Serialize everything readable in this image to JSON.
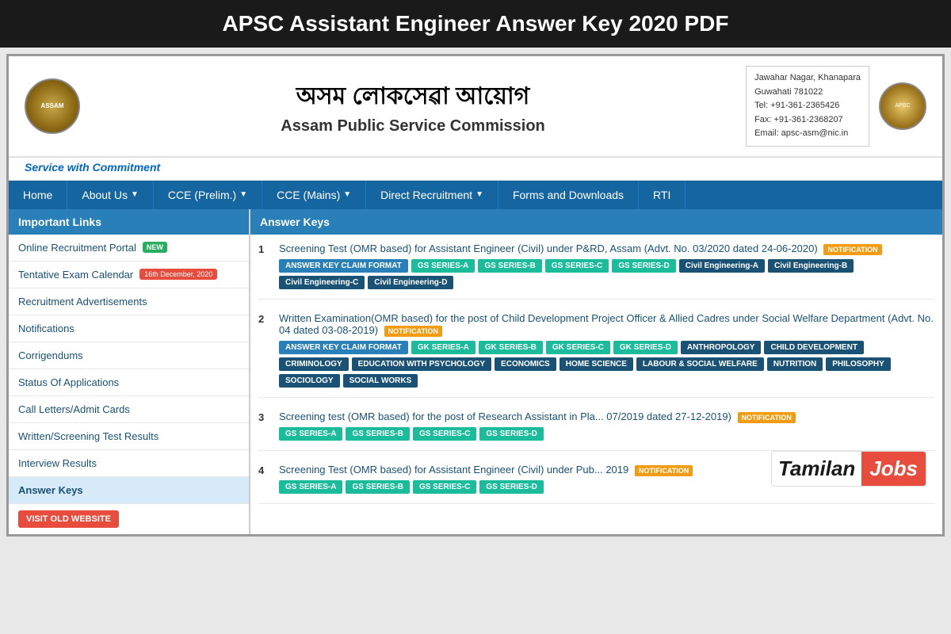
{
  "page": {
    "title": "APSC Assistant Engineer Answer Key 2020 PDF"
  },
  "header": {
    "assamese_text": "অসম লোকসেৱা আয়োগ",
    "english_text": "Assam Public Service Commission",
    "tagline": "Service with Commitment",
    "address": {
      "line1": "Jawahar Nagar, Khanapara",
      "line2": "Guwahati 781022",
      "line3": "Tel: +91-361-2365426",
      "line4": "Fax: +91-361-2368207",
      "line5": "Email: apsc-asm@nic.in"
    }
  },
  "nav": {
    "items": [
      {
        "label": "Home",
        "dropdown": false
      },
      {
        "label": "About Us",
        "dropdown": true
      },
      {
        "label": "CCE (Prelim.)",
        "dropdown": true
      },
      {
        "label": "CCE (Mains)",
        "dropdown": true
      },
      {
        "label": "Direct Recruitment",
        "dropdown": true
      },
      {
        "label": "Forms and Downloads",
        "dropdown": false
      },
      {
        "label": "RTI",
        "dropdown": false
      }
    ]
  },
  "sidebar": {
    "header": "Important Links",
    "items": [
      {
        "label": "Online Recruitment Portal",
        "badge": "NEW",
        "badge_type": "new"
      },
      {
        "label": "Tentative Exam Calendar",
        "badge": "16th December, 2020",
        "badge_type": "date"
      },
      {
        "label": "Recruitment Advertisements"
      },
      {
        "label": "Notifications"
      },
      {
        "label": "Corrigendums"
      },
      {
        "label": "Status Of Applications"
      },
      {
        "label": "Call Letters/Admit Cards"
      },
      {
        "label": "Written/Screening Test Results"
      },
      {
        "label": "Interview Results"
      },
      {
        "label": "Answer Keys"
      }
    ],
    "visit_old_website": "VISIT OLD WEBSITE"
  },
  "answer_keys": {
    "header": "Answer Keys",
    "items": [
      {
        "num": "1",
        "title": "Screening Test (OMR based) for Assistant Engineer (Civil) under P&RD, Assam (Advt. No. 03/2020 dated 24-06-2020)",
        "has_notification": true,
        "buttons": [
          {
            "label": "ANSWER KEY CLAIM FORMAT",
            "color": "blue"
          },
          {
            "label": "GS SERIES-A",
            "color": "teal"
          },
          {
            "label": "GS SERIES-B",
            "color": "teal"
          },
          {
            "label": "GS SERIES-C",
            "color": "teal"
          },
          {
            "label": "GS SERIES-D",
            "color": "teal"
          },
          {
            "label": "Civil Engineering-A",
            "color": "dark-blue"
          },
          {
            "label": "Civil Engineering-B",
            "color": "dark-blue"
          },
          {
            "label": "Civil Engineering-C",
            "color": "dark-blue"
          },
          {
            "label": "Civil Engineering-D",
            "color": "dark-blue"
          }
        ]
      },
      {
        "num": "2",
        "title": "Written Examination(OMR based) for the post of Child Development Project Officer & Allied Cadres under Social Welfare Department (Advt. No. 04 dated 03-08-2019)",
        "has_notification": true,
        "buttons": [
          {
            "label": "ANSWER KEY CLAIM FORMAT",
            "color": "blue"
          },
          {
            "label": "GK SERIES-A",
            "color": "teal"
          },
          {
            "label": "GK SERIES-B",
            "color": "teal"
          },
          {
            "label": "GK SERIES-C",
            "color": "teal"
          },
          {
            "label": "GK SERIES-D",
            "color": "teal"
          },
          {
            "label": "ANTHROPOLOGY",
            "color": "dark-blue"
          },
          {
            "label": "CHILD DEVELOPMENT",
            "color": "dark-blue"
          },
          {
            "label": "CRIMINOLOGY",
            "color": "dark-blue"
          },
          {
            "label": "EDUCATION WITH PSYCHOLOGY",
            "color": "dark-blue"
          },
          {
            "label": "ECONOMICS",
            "color": "dark-blue"
          },
          {
            "label": "HOME SCIENCE",
            "color": "dark-blue"
          },
          {
            "label": "LABOUR & SOCIAL WELFARE",
            "color": "dark-blue"
          },
          {
            "label": "NUTRITION",
            "color": "dark-blue"
          },
          {
            "label": "PHILOSOPHY",
            "color": "dark-blue"
          },
          {
            "label": "SOCIOLOGY",
            "color": "dark-blue"
          },
          {
            "label": "SOCIAL WORKS",
            "color": "dark-blue"
          }
        ]
      },
      {
        "num": "3",
        "title": "Screening test (OMR based) for the post of Research Assistant in Pla... 07/2019 dated 27-12-2019)",
        "has_notification": true,
        "buttons": [
          {
            "label": "GS SERIES-A",
            "color": "teal"
          },
          {
            "label": "GS SERIES-B",
            "color": "teal"
          },
          {
            "label": "GS SERIES-C",
            "color": "teal"
          },
          {
            "label": "GS SERIES-D",
            "color": "teal"
          }
        ]
      },
      {
        "num": "4",
        "title": "Screening Test (OMR based) for Assistant Engineer (Civil) under Pub... 2019",
        "has_notification": true,
        "buttons": [
          {
            "label": "GS SERIES-A",
            "color": "teal"
          },
          {
            "label": "GS SERIES-B",
            "color": "teal"
          },
          {
            "label": "GS SERIES-C",
            "color": "teal"
          },
          {
            "label": "GS SERIES-D",
            "color": "teal"
          }
        ]
      }
    ]
  },
  "watermark": {
    "tamilan": "Tamilan",
    "jobs": "Jobs"
  }
}
